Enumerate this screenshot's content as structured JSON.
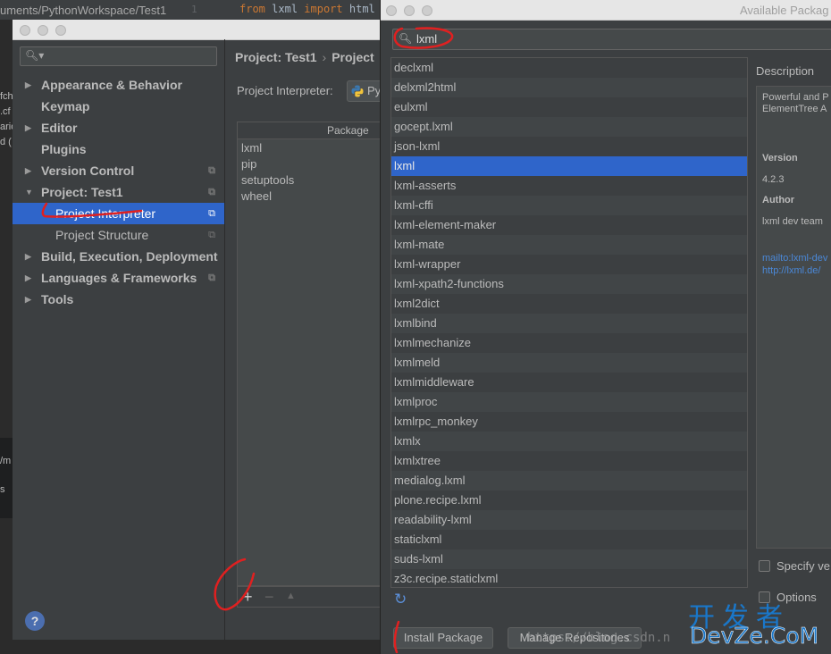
{
  "background_editor": {
    "path": "uments/PythonWorkspace/Test1",
    "line_number": "1",
    "code_keyword_from": "from",
    "code_module": "lxml",
    "code_keyword_import": "import",
    "code_name": "html",
    "left_fragments": [
      "fch",
      ".cf",
      "",
      "ario",
      "d ("
    ],
    "terminal_fragments": [
      "/m",
      "s"
    ]
  },
  "preferences": {
    "search_placeholder": "",
    "nav": [
      {
        "label": "Appearance & Behavior",
        "arrow": "▶",
        "level": 0,
        "copy": ""
      },
      {
        "label": "Keymap",
        "arrow": "",
        "level": 0,
        "copy": ""
      },
      {
        "label": "Editor",
        "arrow": "▶",
        "level": 0,
        "copy": ""
      },
      {
        "label": "Plugins",
        "arrow": "",
        "level": 0,
        "copy": ""
      },
      {
        "label": "Version Control",
        "arrow": "▶",
        "level": 0,
        "copy": "⧉"
      },
      {
        "label": "Project: Test1",
        "arrow": "▼",
        "level": 0,
        "copy": "⧉"
      },
      {
        "label": "Project Interpreter",
        "arrow": "",
        "level": 1,
        "copy": "⧉",
        "selected": true
      },
      {
        "label": "Project Structure",
        "arrow": "",
        "level": 1,
        "copy": "⧉"
      },
      {
        "label": "Build, Execution, Deployment",
        "arrow": "▶",
        "level": 0,
        "copy": ""
      },
      {
        "label": "Languages & Frameworks",
        "arrow": "▶",
        "level": 0,
        "copy": "⧉"
      },
      {
        "label": "Tools",
        "arrow": "▶",
        "level": 0,
        "copy": ""
      }
    ],
    "help_label": "?",
    "breadcrumb_project": "Project: Test1",
    "breadcrumb_sep": "›",
    "breadcrumb_current": "Project",
    "interpreter_label": "Project Interpreter:",
    "interpreter_value": "Py",
    "table_header": "Package",
    "packages": [
      "lxml",
      "pip",
      "setuptools",
      "wheel"
    ],
    "add_label": "+",
    "remove_label": "−",
    "up_label": "▲"
  },
  "available_packages": {
    "title": "Available Packag",
    "search_value": "lxml",
    "list": [
      "declxml",
      "delxml2html",
      "eulxml",
      "gocept.lxml",
      "json-lxml",
      "lxml",
      "lxml-asserts",
      "lxml-cffi",
      "lxml-element-maker",
      "lxml-mate",
      "lxml-wrapper",
      "lxml-xpath2-functions",
      "lxml2dict",
      "lxmlbind",
      "lxmlmechanize",
      "lxmlmeld",
      "lxmlmiddleware",
      "lxmlproc",
      "lxmlrpc_monkey",
      "lxmlx",
      "lxmlxtree",
      "medialog.lxml",
      "plone.recipe.lxml",
      "readability-lxml",
      "staticlxml",
      "suds-lxml",
      "z3c.recipe.staticlxml"
    ],
    "selected": "lxml",
    "refresh_icon": "↻",
    "description_label": "Description",
    "description_text_1": "Powerful and P",
    "description_text_2": "ElementTree A",
    "version_heading": "Version",
    "version": "4.2.3",
    "author_heading": "Author",
    "author": "lxml dev team",
    "mailto": "mailto:lxml-dev",
    "url": "http://lxml.de/",
    "specify_version_label": "Specify ve",
    "options_label": "Options",
    "install_label": "Install Package",
    "manage_label": "Manage Repositories"
  },
  "watermark": {
    "cn": "开发者",
    "en": "DevZe.CoM",
    "blog": "https://blog.csdn.n"
  },
  "colors": {
    "selection": "#2f65ca",
    "annotation": "#e02020",
    "link": "#4a88d8",
    "watermark": "#1a77c9"
  }
}
